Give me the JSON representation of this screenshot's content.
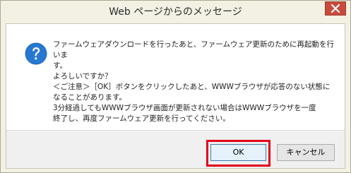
{
  "window": {
    "title": "Web ページからのメッセージ"
  },
  "dialog": {
    "icon": "question-icon",
    "message": "ファームウェアダウンロードを行ったあと、ファームウェア更新のために再起動を行いま\nす。\nよろしいですか？\n＜ご注意＞［OK］ボタンをクリックしたあと、WWWブラウザが応答のない状態に\nなることがあります。\n3分経過してもWWWブラウザ画面が更新されない場合はWWWブラウザを一度\n終了し、再度ファームウェア更新を行ってください。"
  },
  "buttons": {
    "ok_label": "OK",
    "cancel_label": "キャンセル"
  },
  "colors": {
    "highlight": "#e2001a",
    "close_button": "#c74c3c",
    "icon": "#1f6fc4"
  }
}
